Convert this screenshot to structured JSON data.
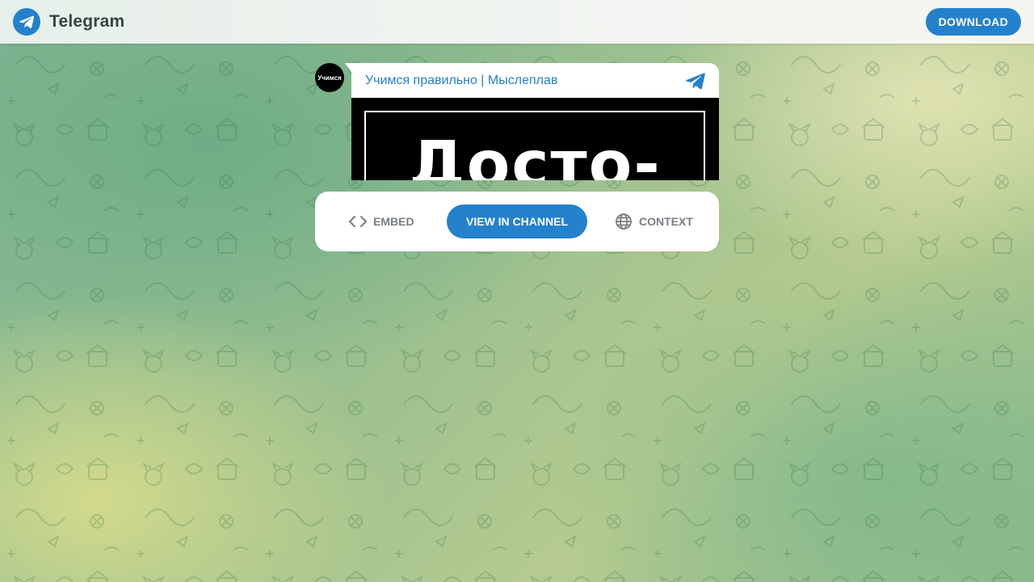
{
  "header": {
    "brand": "Telegram",
    "download_label": "DOWNLOAD"
  },
  "post": {
    "channel_name": "Учимся правильно | Мыслеплав",
    "avatar_text": "Учимся",
    "image_text": "Досто-"
  },
  "actions": {
    "embed_label": "EMBED",
    "view_label": "VIEW IN CHANNEL",
    "context_label": "CONTEXT"
  },
  "colors": {
    "accent": "#2481cc",
    "muted": "#787e83"
  },
  "icons": {
    "logo": "telegram-logo-icon",
    "plane": "telegram-plane-icon",
    "embed": "code-icon",
    "context": "globe-icon"
  }
}
